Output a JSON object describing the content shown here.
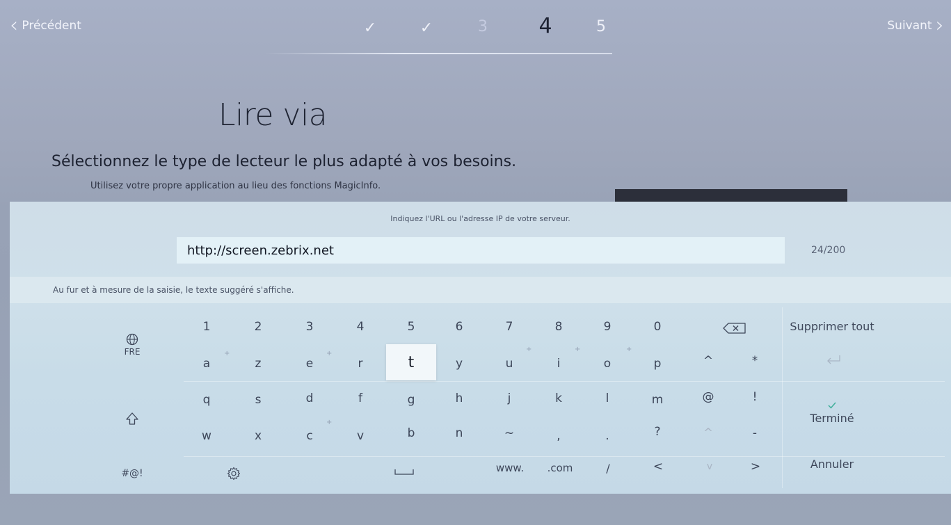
{
  "nav": {
    "prev_label": "Précédent",
    "next_label": "Suivant",
    "steps": [
      "✓",
      "✓",
      "3",
      "4",
      "5"
    ],
    "current_step": "4"
  },
  "page": {
    "title": "Lire via",
    "description": "Sélectionnez le type de lecteur le plus adapté à vos besoins.",
    "subtitle": "Utilisez votre propre application au lieu des fonctions MagicInfo."
  },
  "keyboard": {
    "prompt": "Indiquez l'URL ou l'adresse IP de votre serveur.",
    "input_value": "http://screen.zebrix.net",
    "char_count": "24/200",
    "suggestion_hint": "Au fur et à mesure de la saisie, le texte suggéré s'affiche.",
    "language_label": "FRE",
    "symbols_label": "#@!",
    "rows": [
      [
        "1",
        "2",
        "3",
        "4",
        "5",
        "6",
        "7",
        "8",
        "9",
        "0"
      ],
      [
        "a",
        "z",
        "e",
        "r",
        "t",
        "y",
        "u",
        "i",
        "o",
        "p",
        "^",
        "*"
      ],
      [
        "q",
        "s",
        "d",
        "f",
        "g",
        "h",
        "j",
        "k",
        "l",
        "m",
        "@",
        "!"
      ],
      [
        "w",
        "x",
        "c",
        "v",
        "b",
        "n",
        "~",
        ",",
        ".",
        "?",
        "^",
        "-"
      ]
    ],
    "bottom_keys": {
      "www": "www.",
      "com": ".com",
      "slash": "/",
      "left": "<",
      "down": "v",
      "right": ">"
    },
    "selected_key": "t",
    "actions": {
      "delete_all": "Supprimer tout",
      "done": "Terminé",
      "cancel": "Annuler"
    }
  },
  "colors": {
    "background": "#9ba5b8",
    "keyboard_panel": "#cfdde8",
    "input_field": "#e3f1f7",
    "done_check": "#3fae9a"
  }
}
